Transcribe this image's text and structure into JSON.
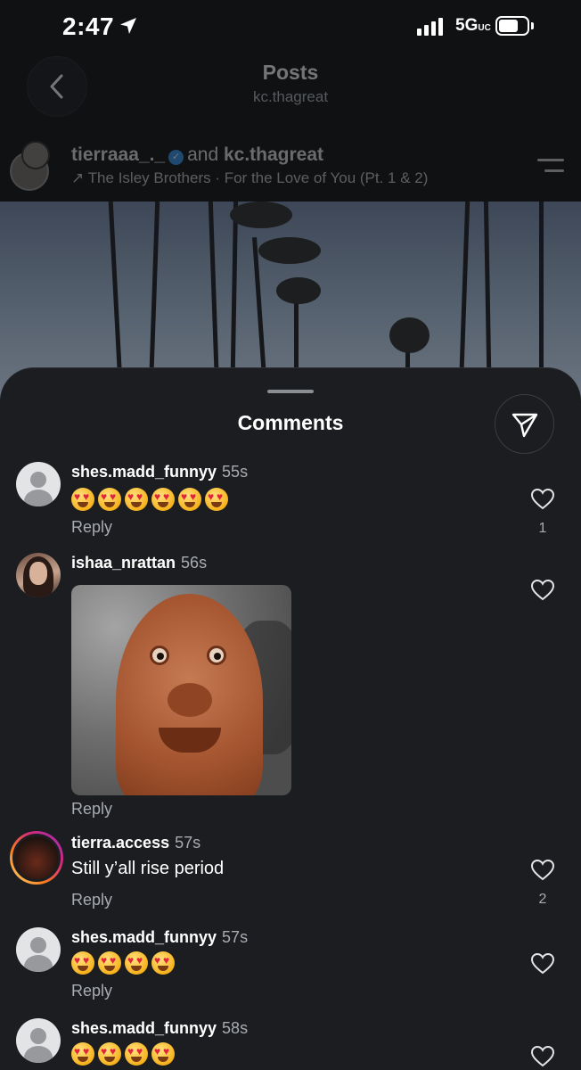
{
  "status_bar": {
    "time": "2:47",
    "network": "5G",
    "network_suffix": "UC"
  },
  "header": {
    "title": "Posts",
    "subtitle": "kc.thagreat"
  },
  "post": {
    "author1": "tierraaa_._",
    "joiner": "and",
    "author2": "kc.thagreat",
    "music": "The Isley Brothers · For the Love of You (Pt. 1 & 2)"
  },
  "sheet": {
    "title": "Comments"
  },
  "comments": [
    {
      "user": "shes.madd_funnyy",
      "age": "55s",
      "emoji_count": 6,
      "reply": "Reply",
      "likes": "1"
    },
    {
      "user": "ishaa_nrattan",
      "age": "56s",
      "reply": "Reply",
      "likes": ""
    },
    {
      "user": "tierra.access",
      "age": "57s",
      "text": "Still y’all rise period",
      "reply": "Reply",
      "likes": "2"
    },
    {
      "user": "shes.madd_funnyy",
      "age": "57s",
      "emoji_count": 4,
      "reply": "Reply",
      "likes": ""
    },
    {
      "user": "shes.madd_funnyy",
      "age": "58s",
      "emoji_count": 4,
      "reply": "",
      "likes": ""
    }
  ],
  "colors": {
    "sheet_bg": "#1b1d20",
    "secondary_text": "#a8abb0",
    "verified": "#3897f0"
  }
}
